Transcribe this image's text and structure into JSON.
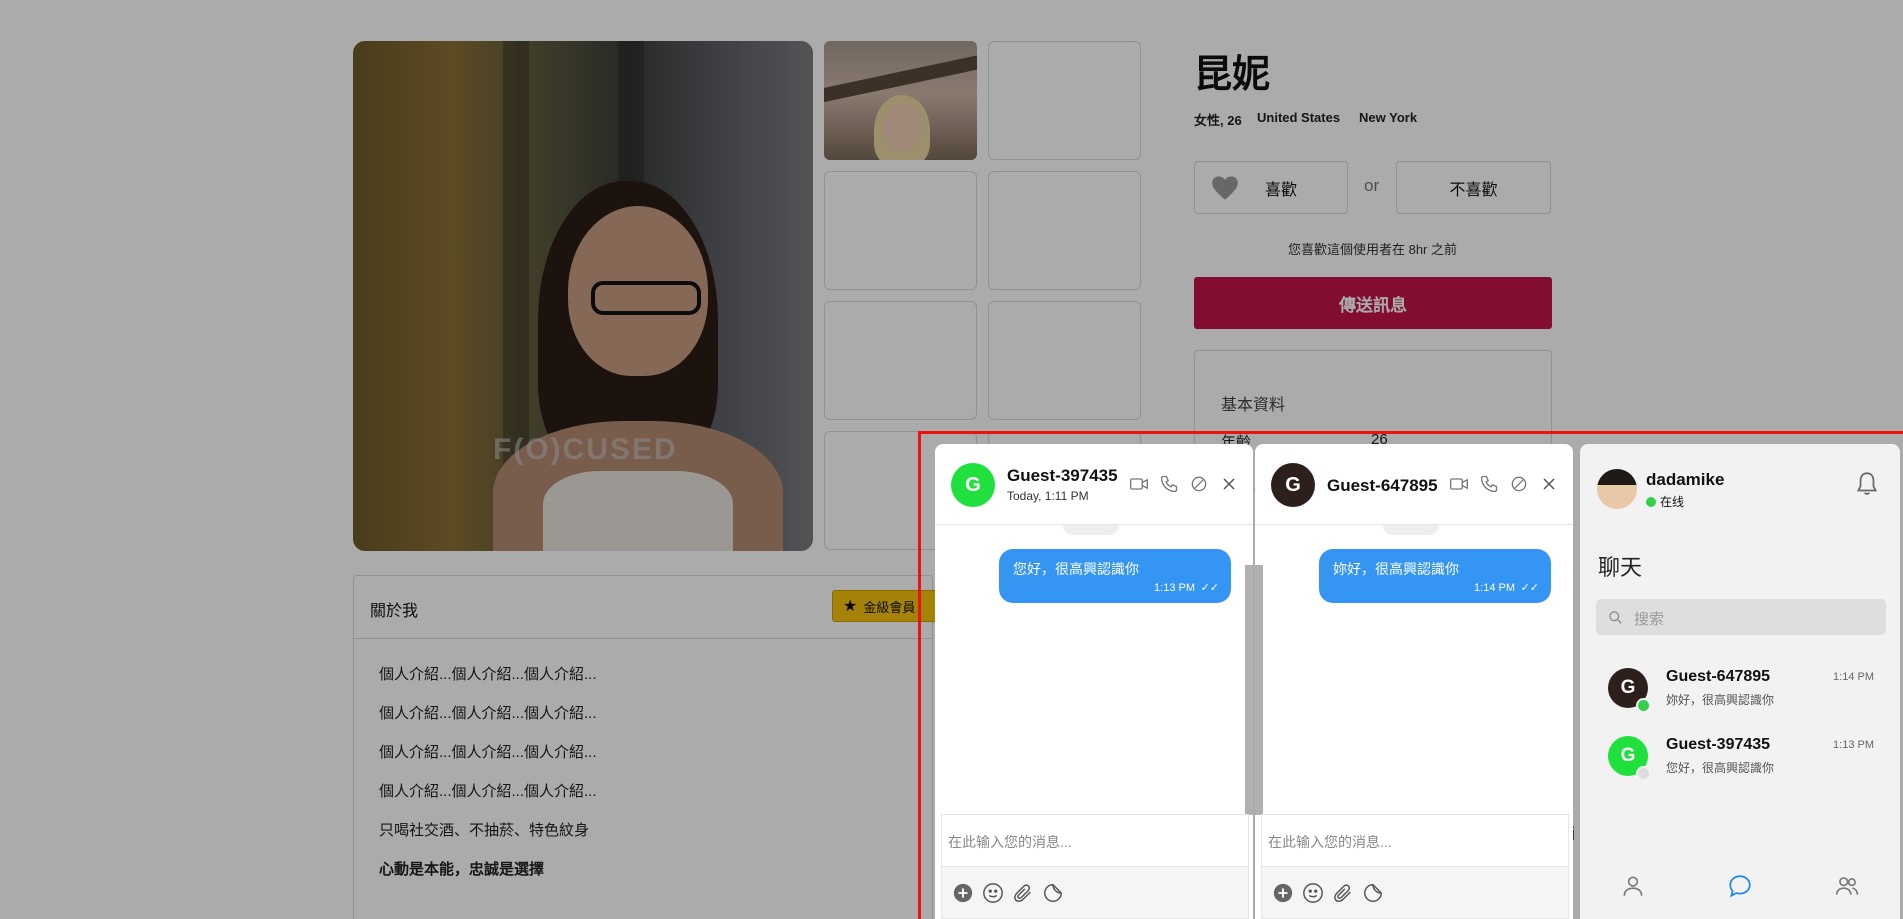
{
  "profile": {
    "name": "昆妮",
    "gender_age": "女性, 26",
    "country": "United States",
    "city": "New York",
    "like_label": "喜歡",
    "or_label": "or",
    "dislike_label": "不喜歡",
    "liked_note": "您喜歡這個使用者在 8hr 之前",
    "send_label": "傳送訊息",
    "photo_watermark": "F(O)CUSED",
    "basic": {
      "title": "基本資料",
      "age_label": "年齡",
      "age_value": "26"
    }
  },
  "about": {
    "title": "關於我",
    "badge": "金級會員",
    "lines": [
      "個人介紹...個人介紹...個人介紹...",
      "個人介紹...個人介紹...個人介紹...",
      "個人介紹...個人介紹...個人介紹...",
      "個人介紹...個人介紹...個人介紹...",
      "只喝社交酒、不抽菸、特色紋身",
      "心動是本能，忠誠是選擇"
    ]
  },
  "chat_windows": [
    {
      "avatar_letter": "G",
      "avatar_color": "#1fe03c",
      "name": "Guest-397435",
      "subtitle": "Today, 1:11 PM",
      "message": "您好，很高興認識你",
      "message_time": "1:13 PM",
      "input_placeholder": "在此输入您的消息..."
    },
    {
      "avatar_letter": "G",
      "avatar_color": "#2d1f1c",
      "name": "Guest-647895",
      "subtitle": "",
      "message": "妳好，很高興認識你",
      "message_time": "1:14 PM",
      "input_placeholder": "在此输入您的消息..."
    }
  ],
  "sidebar": {
    "user_name": "dadamike",
    "status": "在线",
    "status_color": "#35d04a",
    "title": "聊天",
    "search_placeholder": "搜索",
    "conversations": [
      {
        "avatar_letter": "G",
        "avatar_color": "#2d1f1c",
        "name": "Guest-647895",
        "preview": "妳好，很高興認識你",
        "time": "1:14 PM",
        "online_color": "#35d04a"
      },
      {
        "avatar_letter": "G",
        "avatar_color": "#1fe03c",
        "name": "Guest-397435",
        "preview": "您好，很高興認識你",
        "time": "1:13 PM",
        "online_color": "#dddddd"
      }
    ]
  },
  "background_fragment": "i"
}
